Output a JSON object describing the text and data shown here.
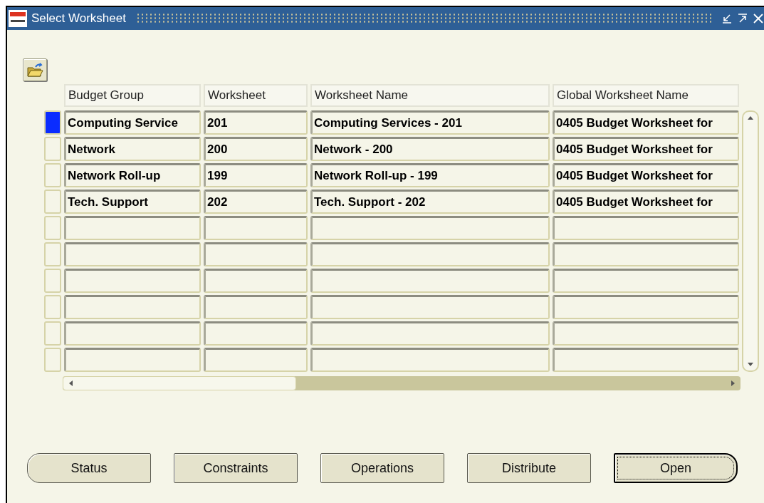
{
  "window": {
    "title": "Select Worksheet"
  },
  "table": {
    "columns": [
      "Budget Group",
      "Worksheet",
      "Worksheet Name",
      "Global Worksheet Name"
    ],
    "rows": [
      {
        "selected": true,
        "cells": [
          "Computing Service",
          "201",
          "Computing Services - 201",
          "0405 Budget Worksheet for"
        ]
      },
      {
        "selected": false,
        "cells": [
          "Network",
          "200",
          "Network - 200",
          "0405 Budget Worksheet for"
        ]
      },
      {
        "selected": false,
        "cells": [
          "Network Roll-up",
          "199",
          "Network Roll-up - 199",
          "0405 Budget Worksheet for"
        ]
      },
      {
        "selected": false,
        "cells": [
          "Tech. Support",
          "202",
          "Tech. Support - 202",
          "0405 Budget Worksheet for"
        ]
      },
      {
        "selected": false
      },
      {
        "selected": false
      },
      {
        "selected": false
      },
      {
        "selected": false
      },
      {
        "selected": false
      },
      {
        "selected": false
      }
    ]
  },
  "buttons": [
    {
      "label": "Status",
      "kind": "left"
    },
    {
      "label": "Constraints",
      "kind": "plain"
    },
    {
      "label": "Operations",
      "kind": "plain"
    },
    {
      "label": "Distribute",
      "kind": "plain"
    },
    {
      "label": "Open",
      "kind": "default"
    }
  ]
}
